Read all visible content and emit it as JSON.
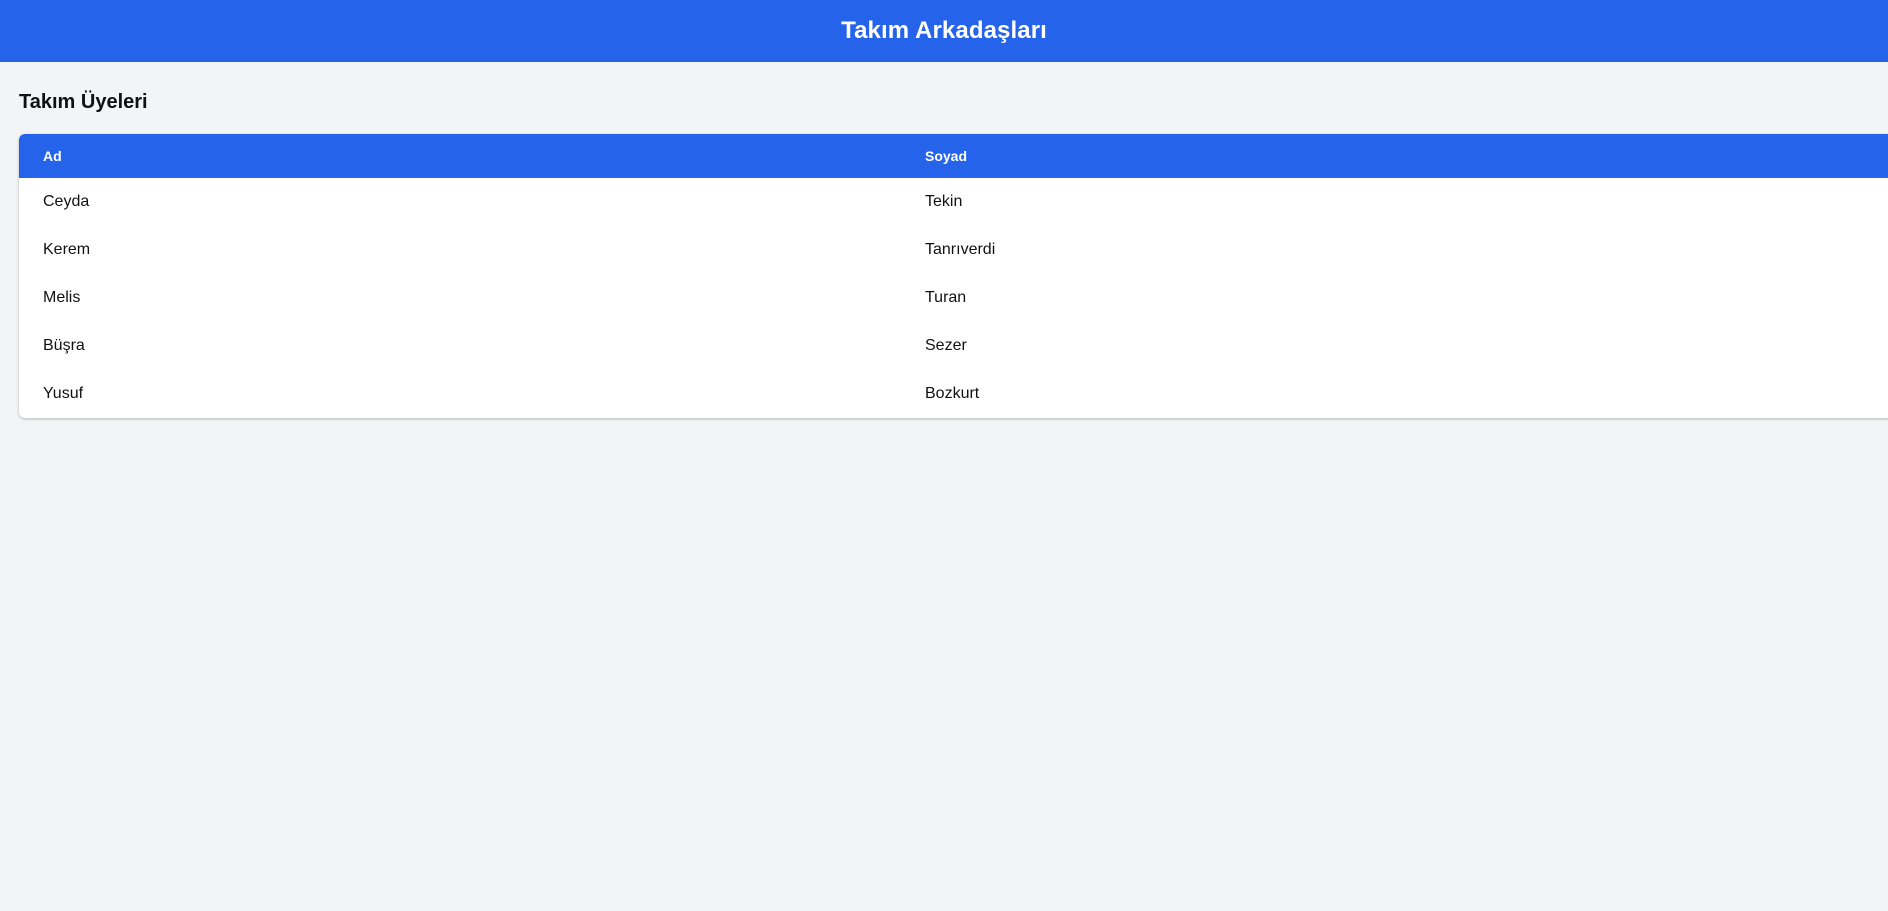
{
  "header": {
    "title": "Takım Arkadaşları"
  },
  "section": {
    "title": "Takım Üyeleri"
  },
  "table": {
    "columns": [
      "Ad",
      "Soyad"
    ],
    "rows": [
      [
        "Ceyda",
        "Tekin"
      ],
      [
        "Kerem",
        "Tanrıverdi"
      ],
      [
        "Melis",
        "Turan"
      ],
      [
        "Büşra",
        "Sezer"
      ],
      [
        "Yusuf",
        "Bozkurt"
      ]
    ]
  },
  "colors": {
    "accent": "#2563eb",
    "background": "#f3f4f6",
    "card": "#ffffff"
  }
}
